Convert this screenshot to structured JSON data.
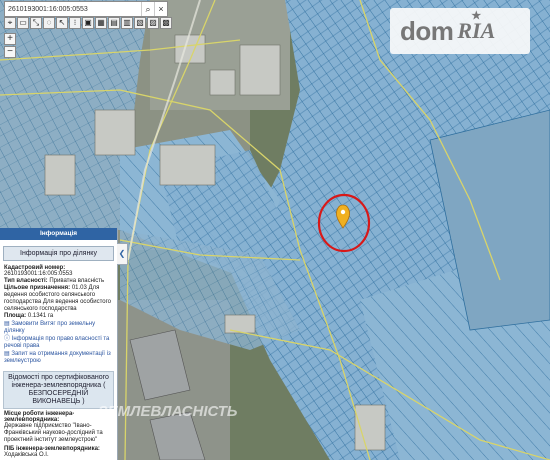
{
  "search": {
    "value": "2610193001:16:005:0553"
  },
  "toolbar": [
    "⌖",
    "▭",
    "⤡",
    "◌",
    "↖",
    "⁝",
    "▣",
    "▦",
    "▤",
    "▥",
    "▧",
    "▨",
    "▩"
  ],
  "zoom": {
    "in": "+",
    "out": "−"
  },
  "logo": {
    "dom": "dom",
    "ria": "RIA"
  },
  "panel": {
    "header": "Інформація",
    "tab": "Інформація про ділянку",
    "cadastre_label": "Кадастровий номер:",
    "cadastre_value": "2610193001:16:005:0553",
    "ownership_label": "Тип власності:",
    "ownership_value": "Приватна власність",
    "purpose_label": "Цільове призначення:",
    "purpose_value": "01.03 Для ведення особистого селянського господарства Для ведення особистого селянського господарства",
    "area_label": "Площа:",
    "area_value": "0.1341 га",
    "link_extract": "Замовити Витяг про земельну ділянку",
    "link_rights": "Інформація про право власності та речові права",
    "link_docs": "Запит на отримання документації із землеустрою",
    "box_text": "Відомості про сертифікованого інженера-землевпорядника ( БЕЗПОСЕРЕДНІЙ ВИКОНАВЕЦЬ )",
    "workplace_label": "Місце роботи інженера-землевпорядника:",
    "workplace_value": "Державне підприємство \"Івано-Франківський науково-дослідний та проектний інститут землеустрою\"",
    "engineer_label": "ПІБ інженера-землевпорядника:",
    "engineer_value": "Ходаківська О.І."
  },
  "watermark": "ЗЕМЛЕВЛАСНІСТЬ",
  "colors": {
    "parcel_fill": "#8fb8d6",
    "parcel_stroke": "#2f6f9e",
    "road_yellow": "#d8d46a",
    "marker": "#f0b020",
    "circle": "#d81818"
  }
}
